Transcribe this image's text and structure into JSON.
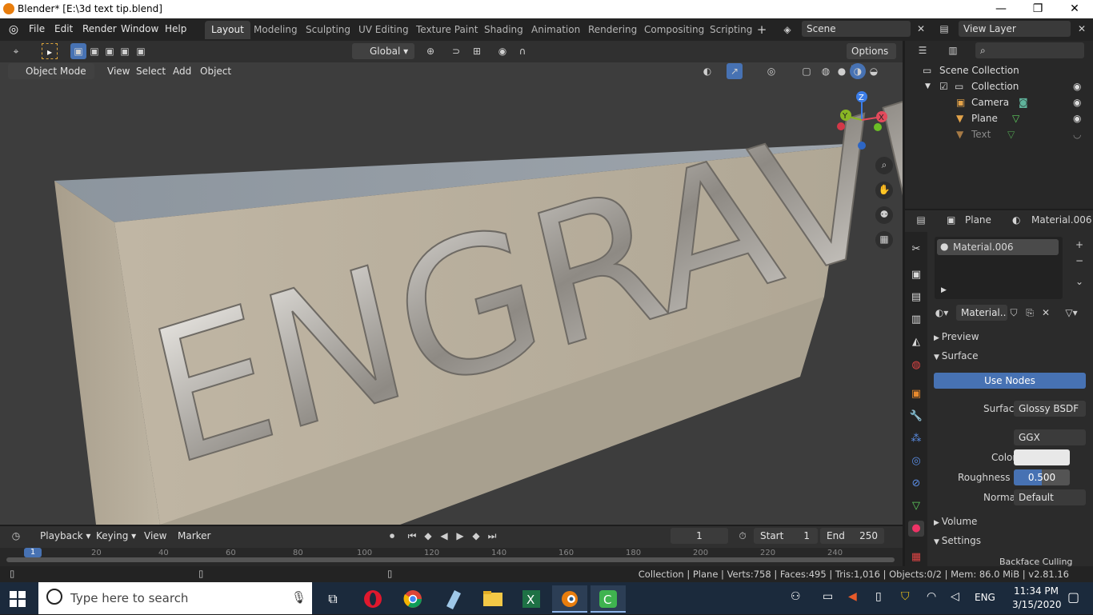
{
  "window": {
    "title": "Blender* [E:\\3d text tip.blend]",
    "minimize": "—",
    "maximize": "❐",
    "close": "✕"
  },
  "menu": [
    "File",
    "Edit",
    "Render",
    "Window",
    "Help"
  ],
  "workspaces": [
    "Layout",
    "Modeling",
    "Sculpting",
    "UV Editing",
    "Texture Paint",
    "Shading",
    "Animation",
    "Rendering",
    "Compositing",
    "Scripting"
  ],
  "active_workspace": "Layout",
  "scene": {
    "name": "Scene",
    "view_layer": "View Layer"
  },
  "toolbar": {
    "orientation": "Global",
    "options": "Options"
  },
  "viewport_header": {
    "mode": "Object Mode",
    "menus": [
      "View",
      "Select",
      "Add",
      "Object"
    ]
  },
  "viewport_text": "ENGRAVE",
  "gizmo": {
    "z": "Z",
    "y": "Y",
    "x": "X"
  },
  "outliner": {
    "root": "Scene Collection",
    "collection": "Collection",
    "items": [
      {
        "name": "Camera",
        "icon": "camera-icon"
      },
      {
        "name": "Plane",
        "icon": "mesh-icon"
      },
      {
        "name": "Text",
        "icon": "text-icon"
      }
    ]
  },
  "properties": {
    "object": "Plane",
    "material": "Material.006",
    "slot": "Material.006",
    "datablock": "Material..",
    "panels": {
      "preview": "Preview",
      "surface": "Surface",
      "volume": "Volume",
      "settings": "Settings",
      "backface": "Backface Culling"
    },
    "use_nodes": "Use Nodes",
    "surface_label": "Surface",
    "surface_value": "Glossy BSDF",
    "distribution": "GGX",
    "color_label": "Color",
    "roughness_label": "Roughness",
    "roughness_value": "0.500",
    "roughness_fraction": 0.5,
    "normal_label": "Normal",
    "normal_value": "Default"
  },
  "timeline": {
    "menus": [
      "Playback",
      "Keying",
      "View",
      "Marker"
    ],
    "current_frame": "1",
    "start_label": "Start",
    "start": "1",
    "end_label": "End",
    "end": "250",
    "ruler": [
      "1",
      "20",
      "40",
      "60",
      "80",
      "100",
      "120",
      "140",
      "160",
      "180",
      "200",
      "220",
      "240"
    ]
  },
  "status": "Collection | Plane | Verts:758 | Faces:495 | Tris:1,016 | Objects:0/2 | Mem: 86.0 MiB | v2.81.16",
  "taskbar": {
    "search_placeholder": "Type here to search",
    "time": "11:34 PM",
    "date": "3/15/2020",
    "lang": "ENG"
  },
  "colors": {
    "accent": "#4772b3",
    "active_tab": "#3d3d3d",
    "taskbar": "#1b2a3c",
    "block": "#c5bba8"
  }
}
